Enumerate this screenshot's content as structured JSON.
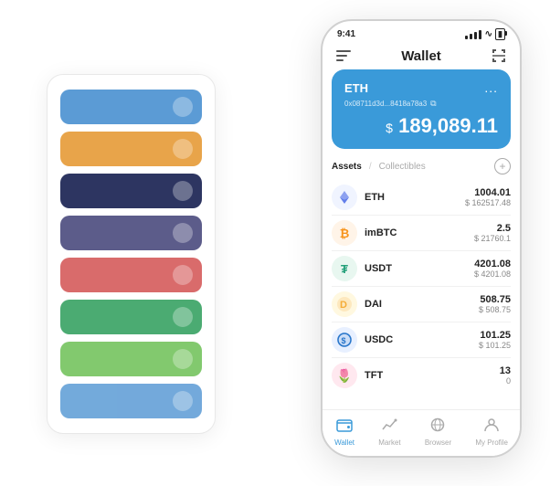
{
  "statusBar": {
    "time": "9:41",
    "signal": "signal",
    "wifi": "wifi",
    "battery": "battery"
  },
  "nav": {
    "menu_icon": "☰",
    "title": "Wallet",
    "scan_icon": "⤢"
  },
  "ethCard": {
    "symbol": "ETH",
    "address": "0x08711d3d...8418a78a3",
    "copy_icon": "⧉",
    "dots": "...",
    "balance_symbol": "$",
    "balance": "189,089.11"
  },
  "assetsSection": {
    "tab_active": "Assets",
    "tab_divider": "/",
    "tab_inactive": "Collectibles",
    "add_icon": "+"
  },
  "assets": [
    {
      "name": "ETH",
      "icon": "◈",
      "icon_class": "icon-eth",
      "amount": "1004.01",
      "usd": "$ 162517.48"
    },
    {
      "name": "imBTC",
      "icon": "₿",
      "icon_class": "icon-imbtc",
      "amount": "2.5",
      "usd": "$ 21760.1"
    },
    {
      "name": "USDT",
      "icon": "₮",
      "icon_class": "icon-usdt",
      "amount": "4201.08",
      "usd": "$ 4201.08"
    },
    {
      "name": "DAI",
      "icon": "◈",
      "icon_class": "icon-dai",
      "amount": "508.75",
      "usd": "$ 508.75"
    },
    {
      "name": "USDC",
      "icon": "$",
      "icon_class": "icon-usdc",
      "amount": "101.25",
      "usd": "$ 101.25"
    },
    {
      "name": "TFT",
      "icon": "🌷",
      "icon_class": "icon-tft",
      "amount": "13",
      "usd": "0"
    }
  ],
  "bottomNav": [
    {
      "icon": "👛",
      "label": "Wallet",
      "active": true
    },
    {
      "icon": "📈",
      "label": "Market",
      "active": false
    },
    {
      "icon": "🌐",
      "label": "Browser",
      "active": false
    },
    {
      "icon": "👤",
      "label": "My Profile",
      "active": false
    }
  ],
  "cardStack": [
    {
      "color_class": "card-blue"
    },
    {
      "color_class": "card-orange"
    },
    {
      "color_class": "card-dark"
    },
    {
      "color_class": "card-purple"
    },
    {
      "color_class": "card-red"
    },
    {
      "color_class": "card-green"
    },
    {
      "color_class": "card-light-green"
    },
    {
      "color_class": "card-steel-blue"
    }
  ]
}
